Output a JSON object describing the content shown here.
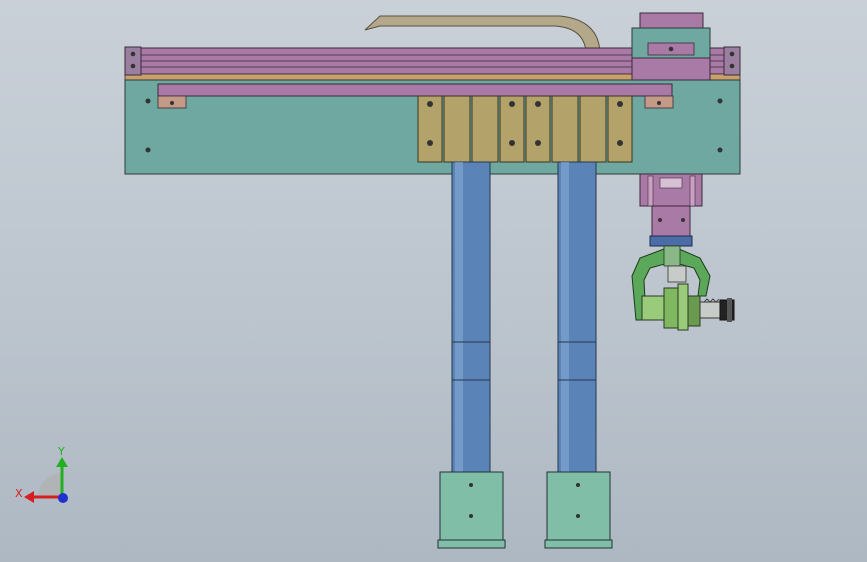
{
  "viewport": {
    "background_top": "#c9d0d8",
    "background_bottom": "#aeb8c2"
  },
  "colors": {
    "frame_plate": "#6fa8a0",
    "rail_purple": "#a97aa6",
    "rail_dark": "#7a5a78",
    "cable_chain": "#b4a88a",
    "clamp_block": "#b3a36a",
    "column_blue": "#5a84b8",
    "column_base": "#80bea8",
    "gripper_green": "#5ca85a",
    "spindle_green": "#9acb7a",
    "bolt": "#333333"
  },
  "triad": {
    "x_label": "X",
    "y_label": "Y",
    "x_color": "#d42020",
    "y_color": "#22b022",
    "z_color": "#2030d0",
    "icon": "coordinate-triad-icon"
  }
}
